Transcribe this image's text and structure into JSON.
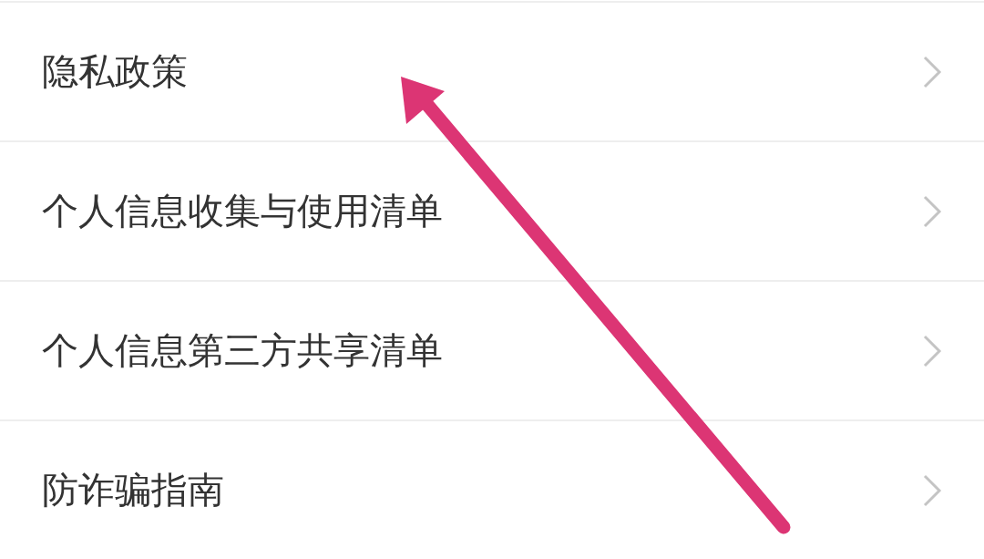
{
  "menu_items": [
    {
      "label": "隐私政策"
    },
    {
      "label": "个人信息收集与使用清单"
    },
    {
      "label": "个人信息第三方共享清单"
    },
    {
      "label": "防诈骗指南"
    }
  ]
}
